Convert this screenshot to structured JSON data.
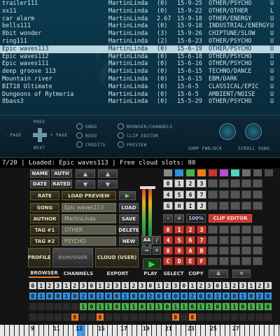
{
  "songs": [
    {
      "name": "trailer111",
      "author": "MartinLinda",
      "rating": "(0)",
      "date": "15-9-25",
      "genre": "OTHER/PSYCHO",
      "flag": "U"
    },
    {
      "name": "xx11",
      "author": "MartinLinda",
      "rating": "(0)",
      "date": "15-9-22",
      "genre": "OTHER/OTHER",
      "flag": "L"
    },
    {
      "name": "car alarm",
      "author": "MartinLinda",
      "rating": "2.67",
      "date": "15-9-18",
      "genre": "OTHER/ENERGY",
      "flag": "U"
    },
    {
      "name": "bells111",
      "author": "MartinLinda",
      "rating": "(0)",
      "date": "15-9-18",
      "genre": "INDUSTRIAL/ENERGY",
      "flag": "U"
    },
    {
      "name": "8bit wonder",
      "author": "MartinLinda",
      "rating": "(3)",
      "date": "15-9-26",
      "genre": "CHIPTUNE/SLOW",
      "flag": "U"
    },
    {
      "name": "ring111",
      "author": "MartinLinda",
      "rating": "(2)",
      "date": "15-6-23",
      "genre": "OTHER/PSYCHO",
      "flag": "U"
    },
    {
      "name": "Epic waves113",
      "author": "MartinLinda",
      "rating": "(0)",
      "date": "15-6-19",
      "genre": "OTHER/PSYCHO",
      "flag": "U"
    },
    {
      "name": "Epic waves112",
      "author": "MartinLinda",
      "rating": "(0)",
      "date": "15-6-18",
      "genre": "OTHER/PSYCHO",
      "flag": "U"
    },
    {
      "name": "Epic waves111",
      "author": "MartinLinda",
      "rating": "(0)",
      "date": "15-6-16",
      "genre": "OTHER/PSYCHO",
      "flag": "U"
    },
    {
      "name": "deep groove 113",
      "author": "MartinLinda",
      "rating": "(0)",
      "date": "15-6-15",
      "genre": "TECHNO/DANCE",
      "flag": "U"
    },
    {
      "name": "Mountain river",
      "author": "MartinLinda",
      "rating": "(0)",
      "date": "15-6-15",
      "genre": "EBM/DARK",
      "flag": "U"
    },
    {
      "name": "BIT18 Ultimate",
      "author": "MartinLinda",
      "rating": "(0)",
      "date": "15-6-5",
      "genre": "CLASSICAL/EPIC",
      "flag": "U"
    },
    {
      "name": "Dungeons of Rytmeria",
      "author": "MartinLinda",
      "rating": "(0)",
      "date": "15-6-5",
      "genre": "AMBIENT/NOISE",
      "flag": "U"
    },
    {
      "name": "8bass3",
      "author": "MartinLinda",
      "rating": "(0)",
      "date": "15-5-29",
      "genre": "OTHER/PSYCHO",
      "flag": "U"
    }
  ],
  "selected_index": 6,
  "controls": {
    "prev": "PREV",
    "next": "NEXT",
    "page_minus": "- PAGE",
    "page_plus": "+ PAGE",
    "undo": "UNDO",
    "redo": "REDO",
    "credits": "CREDITS",
    "browser_channels": "BROWSER/CHANNELS",
    "clip_editor": "CLIP EDITOR",
    "preview": "PREVIEW",
    "jump": "JUMP FWD/BCK",
    "scroll": "SCROLL SONG",
    "btn_b": "B",
    "btn_a": "A",
    "btn_x": "X",
    "btn_y": "Y"
  },
  "status": "7/20 | Loaded: Epic waves113 | Free cloud slots: 80",
  "browser": {
    "sort_name": "NAME",
    "sort_auth": "AUTH",
    "sort_date": "DATE",
    "sort_rated": "RATED",
    "rate": "RATE",
    "load_preview": "LOAD PREVIEW",
    "song_label": "SONG",
    "song_value": "Epic waves113",
    "load": "LOAD",
    "author_label": "AUTHOR",
    "author_value": "MartinLinda",
    "save": "SAVE",
    "tag1_label": "TAG #1",
    "tag1_value": "OTHER",
    "delete": "DELETE",
    "tag2_label": "TAG #2",
    "tag2_value": "PSYCHO",
    "new": "NEW",
    "profile": "PROFILE",
    "rom_user": "ROM/USER",
    "cloud_user": "CLOUD (USER)",
    "arrow_up": "▲",
    "arrow_down": "▼",
    "play_arrow": "▶"
  },
  "keypad": {
    "row1": [
      "0",
      "1",
      "2",
      "3"
    ],
    "row2": [
      "4",
      "5",
      "6",
      "7"
    ],
    "row3": [
      "G",
      "H",
      "I",
      "J"
    ],
    "row4": [
      "K",
      "L"
    ],
    "minus": "-",
    "plus": "+",
    "percent": "100%",
    "clip_editor": "CLIP EDITOR",
    "aa": "AA",
    "row5": [
      "0",
      "1",
      "2",
      "3"
    ],
    "row6": [
      "4",
      "5",
      "6",
      "7"
    ],
    "row7": [
      "8",
      "9",
      "A",
      "B"
    ],
    "row8": [
      "C",
      "D",
      "E",
      "F"
    ]
  },
  "tabs": {
    "browser": "BROWSER",
    "channels": "CHANNELS",
    "export": "EXPORT",
    "play": "PLAY",
    "select": "SELECT",
    "copy": "COPY"
  },
  "pattern": [
    [
      "0",
      "1",
      "2",
      "3",
      "1",
      "2",
      "3",
      "0",
      "1",
      "2",
      "3",
      "1",
      "2",
      "3",
      "0",
      "1",
      "2",
      "3",
      "0",
      "1",
      "2",
      "3",
      "0",
      "1",
      "2",
      "3",
      "1",
      "2",
      "3",
      "0"
    ],
    [
      "0",
      "1",
      "0",
      "0",
      "1",
      "0",
      "2",
      "0",
      "1",
      "0",
      "0",
      "1",
      "0",
      "0",
      "2",
      "0",
      "1",
      "0",
      "0",
      "2",
      "0",
      "0",
      "1",
      "0",
      "0",
      "1",
      "0",
      "2",
      "0",
      "1"
    ],
    [
      "",
      "",
      "",
      "",
      "",
      "",
      "1",
      "0",
      "1",
      "1",
      "0",
      "1",
      "1",
      "0",
      "1",
      "1",
      "0",
      "1",
      "1",
      "0",
      "1",
      "1",
      "0",
      "1",
      "1",
      "0",
      "1",
      "1",
      "0",
      ""
    ],
    [
      "",
      "",
      "",
      "",
      "",
      "8",
      "",
      "",
      "8",
      "",
      "",
      "",
      "",
      "",
      "",
      "",
      "",
      "8",
      "",
      "8",
      "",
      "",
      "",
      "",
      "",
      "",
      "",
      "",
      "",
      ""
    ]
  ],
  "ruler": [
    "9",
    "11",
    "13",
    "15",
    "17",
    "19",
    "21",
    "23",
    "25",
    "27"
  ],
  "colors": {
    "accent": "#f07a1e",
    "selected_row": "#bcd6e2",
    "pattern_white": "#d9d9d9",
    "pattern_blue": "#2f8fe0",
    "pattern_green": "#46b34a",
    "pattern_orange": "#f07a1e",
    "clip_red": "#c23a2e"
  }
}
